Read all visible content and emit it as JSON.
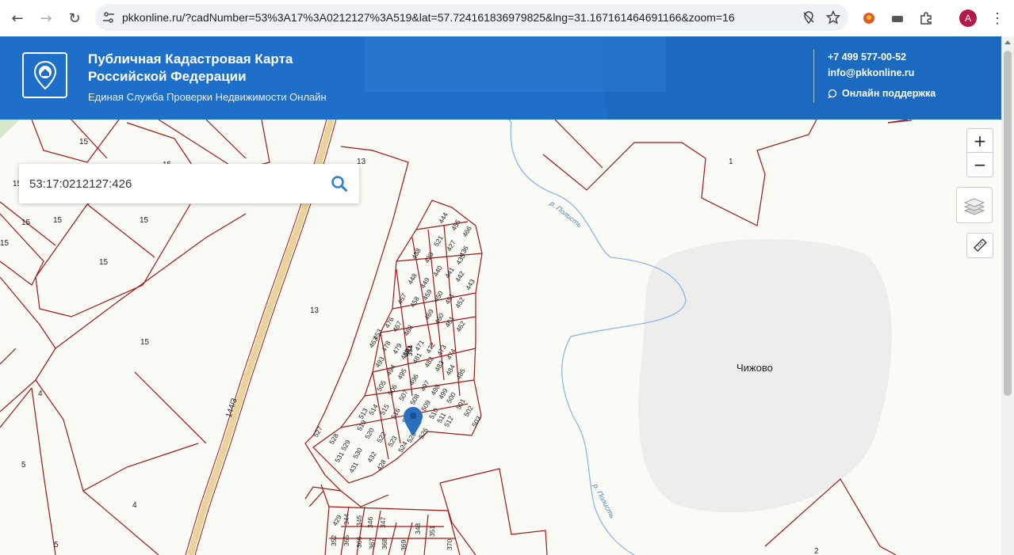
{
  "browser": {
    "url": "pkkonline.ru/?cadNumber=53%3A17%3A0212127%3A519&lat=57.724161836979825&lng=31.167161464691166&zoom=16",
    "back_icon": "back-arrow-icon",
    "forward_icon": "forward-arrow-icon",
    "reload_icon": "reload-icon",
    "profile_initial": "A"
  },
  "header": {
    "title": "Публичная Кадастровая Карта Российской Федерации",
    "subtitle": "Единая Служба Проверки Недвижимости Онлайн",
    "phone": "+7 499 577-00-52",
    "email": "info@pkkonline.ru",
    "support": "Онлайн поддержка"
  },
  "search": {
    "value": "53:17:0212127:426"
  },
  "map": {
    "locality": "Чижово",
    "river1": "р. Полисть",
    "river2": "р. Полисть",
    "road_label": "144/3",
    "plot_labels_left": [
      "15",
      "15",
      "15",
      "15",
      "15",
      "15",
      "15",
      "15",
      "15",
      "13",
      "13",
      "4",
      "5",
      "4",
      "5",
      "1",
      "2"
    ],
    "cluster_labels": [
      "444",
      "455",
      "466",
      "438",
      "439",
      "521",
      "427",
      "436",
      "435",
      "448",
      "449",
      "440",
      "441",
      "442",
      "443",
      "457",
      "458",
      "459",
      "450",
      "451",
      "452",
      "453",
      "476",
      "467",
      "468",
      "469",
      "460",
      "461",
      "462",
      "463",
      "478",
      "479",
      "470",
      "471",
      "472",
      "473",
      "474",
      "480",
      "481",
      "482",
      "483",
      "484",
      "485",
      "493",
      "494",
      "495",
      "496",
      "497",
      "498",
      "499",
      "500",
      "501",
      "502",
      "503",
      "505",
      "506",
      "507",
      "508",
      "509",
      "510",
      "511",
      "512",
      "513",
      "514",
      "515",
      "516",
      "517",
      "518",
      "519",
      "520",
      "522",
      "523",
      "524",
      "525",
      "526",
      "527",
      "528",
      "529",
      "530",
      "531",
      "431",
      "432",
      "428",
      "429",
      "344",
      "345",
      "346",
      "347",
      "348",
      "351",
      "352",
      "365",
      "366",
      "367",
      "368",
      "369",
      "370",
      "371",
      "354"
    ],
    "zoom_in": "+",
    "zoom_out": "−"
  },
  "colors": {
    "header_blue": "#1e6fc9",
    "parcel_border": "#a0151a",
    "river": "#7fb0e0",
    "marker": "#2a6fbf"
  }
}
